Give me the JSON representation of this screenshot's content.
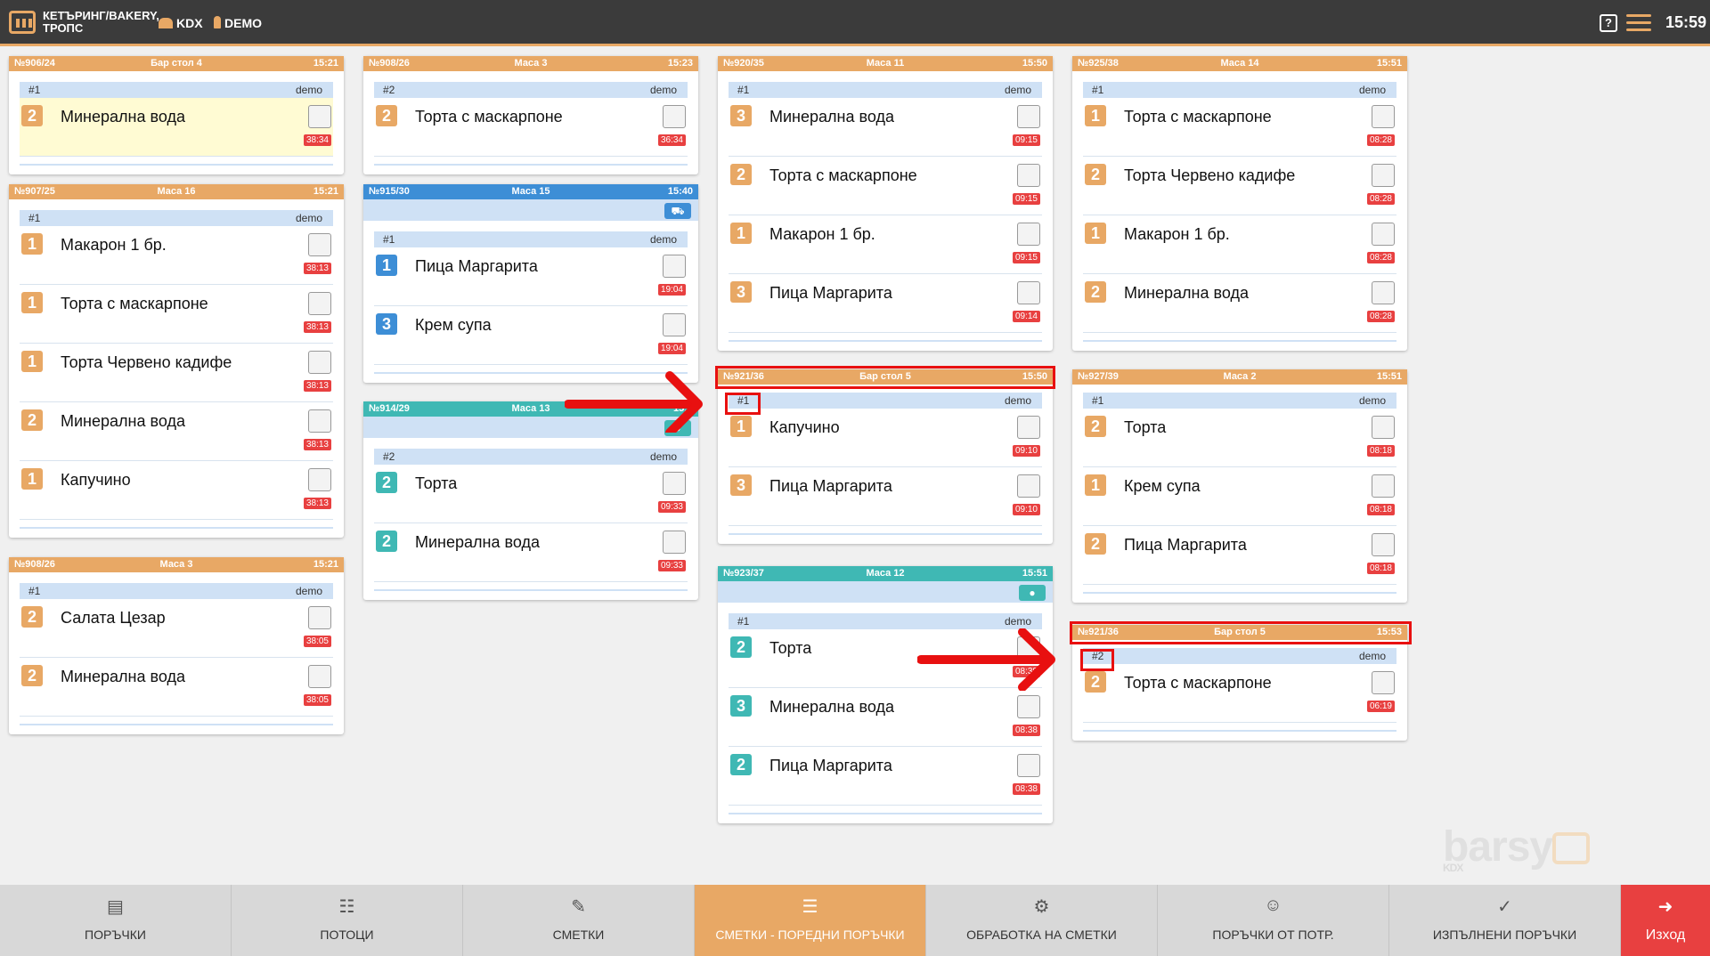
{
  "topbar": {
    "app_name": "КЕТЪРИНГ/BAKERY, ТРОПС",
    "module": "KDX",
    "user": "DEMO",
    "help": "?",
    "clock": "15:59"
  },
  "cards": [
    {
      "num": "№906/24",
      "table": "Бар стол 4",
      "time": "15:21",
      "sub": "#1",
      "who": "demo",
      "items": [
        {
          "q": "2",
          "name": "Минерална вода",
          "elapsed": "38:34"
        }
      ]
    },
    {
      "num": "№907/25",
      "table": "Маса 16",
      "time": "15:21",
      "sub": "#1",
      "who": "demo",
      "items": [
        {
          "q": "1",
          "name": "Макарон 1 бр.",
          "elapsed": "38:13"
        },
        {
          "q": "1",
          "name": "Торта с маскарпоне",
          "elapsed": "38:13"
        },
        {
          "q": "1",
          "name": "Торта Червено кадифе",
          "elapsed": "38:13"
        },
        {
          "q": "2",
          "name": "Минерална вода",
          "elapsed": "38:13"
        },
        {
          "q": "1",
          "name": "Капучино",
          "elapsed": "38:13"
        }
      ]
    },
    {
      "num": "№908/26",
      "table": "Маса 3",
      "time": "15:21",
      "sub": "#1",
      "who": "demo",
      "items": [
        {
          "q": "2",
          "name": "Салата Цезар",
          "elapsed": "38:05"
        },
        {
          "q": "2",
          "name": "Минерална вода",
          "elapsed": "38:05"
        }
      ]
    },
    {
      "num": "№908/26",
      "table": "Маса 3",
      "time": "15:23",
      "sub": "#2",
      "who": "demo",
      "items": [
        {
          "q": "2",
          "name": "Торта с маскарпоне",
          "elapsed": "36:34"
        }
      ]
    },
    {
      "num": "№915/30",
      "table": "Маса 15",
      "time": "15:40",
      "sub": "#1",
      "who": "demo",
      "items": [
        {
          "q": "1",
          "name": "Пица Маргарита",
          "elapsed": "19:04"
        },
        {
          "q": "3",
          "name": "Крем супа",
          "elapsed": "19:04"
        }
      ]
    },
    {
      "num": "№914/29",
      "table": "Маса 13",
      "time": "15:4",
      "sub": "#2",
      "who": "demo",
      "items": [
        {
          "q": "2",
          "name": "Торта",
          "elapsed": "09:33"
        },
        {
          "q": "2",
          "name": "Минерална вода",
          "elapsed": "09:33"
        }
      ]
    },
    {
      "num": "№920/35",
      "table": "Маса 11",
      "time": "15:50",
      "sub": "#1",
      "who": "demo",
      "items": [
        {
          "q": "3",
          "name": "Минерална вода",
          "elapsed": "09:15"
        },
        {
          "q": "2",
          "name": "Торта с маскарпоне",
          "elapsed": "09:15"
        },
        {
          "q": "1",
          "name": "Макарон 1 бр.",
          "elapsed": "09:15"
        },
        {
          "q": "3",
          "name": "Пица Маргарита",
          "elapsed": "09:14"
        }
      ]
    },
    {
      "num": "№921/36",
      "table": "Бар стол 5",
      "time": "15:50",
      "sub": "#1",
      "who": "demo",
      "items": [
        {
          "q": "1",
          "name": "Капучино",
          "elapsed": "09:10"
        },
        {
          "q": "3",
          "name": "Пица Маргарита",
          "elapsed": "09:10"
        }
      ]
    },
    {
      "num": "№923/37",
      "table": "Маса 12",
      "time": "15:51",
      "sub": "#1",
      "who": "demo",
      "items": [
        {
          "q": "2",
          "name": "Торта",
          "elapsed": "08:38"
        },
        {
          "q": "3",
          "name": "Минерална вода",
          "elapsed": "08:38"
        },
        {
          "q": "2",
          "name": "Пица Маргарита",
          "elapsed": "08:38"
        }
      ]
    },
    {
      "num": "№925/38",
      "table": "Маса 14",
      "time": "15:51",
      "sub": "#1",
      "who": "demo",
      "items": [
        {
          "q": "1",
          "name": "Торта с маскарпоне",
          "elapsed": "08:28"
        },
        {
          "q": "2",
          "name": "Торта Червено кадифе",
          "elapsed": "08:28"
        },
        {
          "q": "1",
          "name": "Макарон 1 бр.",
          "elapsed": "08:28"
        },
        {
          "q": "2",
          "name": "Минерална вода",
          "elapsed": "08:28"
        }
      ]
    },
    {
      "num": "№927/39",
      "table": "Маса 2",
      "time": "15:51",
      "sub": "#1",
      "who": "demo",
      "items": [
        {
          "q": "2",
          "name": "Торта",
          "elapsed": "08:18"
        },
        {
          "q": "1",
          "name": "Крем супа",
          "elapsed": "08:18"
        },
        {
          "q": "2",
          "name": "Пица Маргарита",
          "elapsed": "08:18"
        }
      ]
    },
    {
      "num": "№921/36",
      "table": "Бар стол 5",
      "time": "15:53",
      "sub": "#2",
      "who": "demo",
      "items": [
        {
          "q": "2",
          "name": "Торта с маскарпоне",
          "elapsed": "06:19"
        }
      ]
    }
  ],
  "bottom_tabs": [
    {
      "label": "ПОРЪЧКИ",
      "icon": "list-icon"
    },
    {
      "label": "ПОТОЦИ",
      "icon": "flow-icon"
    },
    {
      "label": "СМЕТКИ",
      "icon": "receipt-icon"
    },
    {
      "label": "СМЕТКИ - ПОРЕДНИ ПОРЪЧКИ",
      "icon": "numbered-list-icon"
    },
    {
      "label": "ОБРАБОТКА НА СМЕТКИ",
      "icon": "document-gear-icon"
    },
    {
      "label": "ПОРЪЧКИ ОТ ПОТР.",
      "icon": "user-check-icon"
    },
    {
      "label": "ИЗПЪЛНЕНИ ПОРЪЧКИ",
      "icon": "clipboard-check-icon"
    },
    {
      "label": "Изход",
      "icon": "exit-icon"
    }
  ],
  "brand": {
    "name": "barsy",
    "sub": "KDX"
  },
  "colors": {
    "orange": "#e8a865",
    "blue": "#3d8ed6",
    "teal": "#3fb8b4",
    "red": "#e84040",
    "annotation_red": "#e81010"
  }
}
